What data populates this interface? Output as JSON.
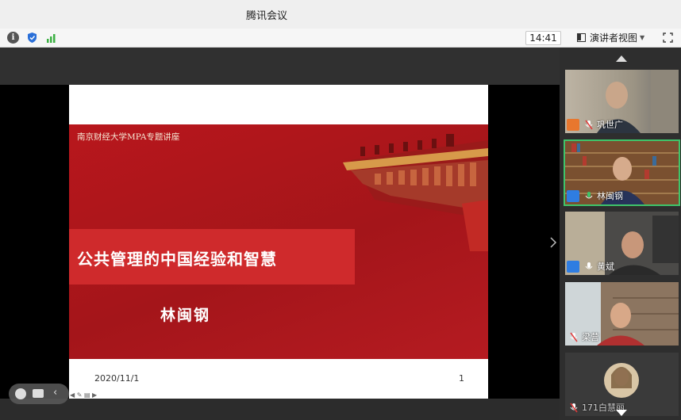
{
  "window": {
    "title": "腾讯会议"
  },
  "toolbar": {
    "time": "14:41",
    "view_label": "演讲者视图",
    "icons": [
      "info-icon",
      "shield-icon",
      "signal-icon",
      "layout-icon",
      "chevron-down-icon",
      "fullscreen-icon"
    ]
  },
  "slide": {
    "subtitle": "南京财经大学MPA专题讲座",
    "title": "公共管理的中国经验和智慧",
    "speaker": "林闽钢",
    "date": "2020/11/1",
    "page": "1"
  },
  "participants": [
    {
      "name": "巩世广",
      "mic": "muted",
      "has_video": true,
      "avatar_color": "#e8772e"
    },
    {
      "name": "林闽钢",
      "mic": "active",
      "has_video": true,
      "speaking": true,
      "avatar_color": "#2f7de1"
    },
    {
      "name": "黄斌",
      "mic": "on",
      "has_video": true,
      "avatar_color": "#2f7de1"
    },
    {
      "name": "梁营",
      "mic": "muted",
      "has_video": true
    },
    {
      "name": "171白慧丽",
      "mic": "muted",
      "has_video": false
    }
  ],
  "colors": {
    "slide_red": "#b8171c",
    "title_band": "#cf2a2c",
    "speaking_outline": "#3fc46a"
  }
}
